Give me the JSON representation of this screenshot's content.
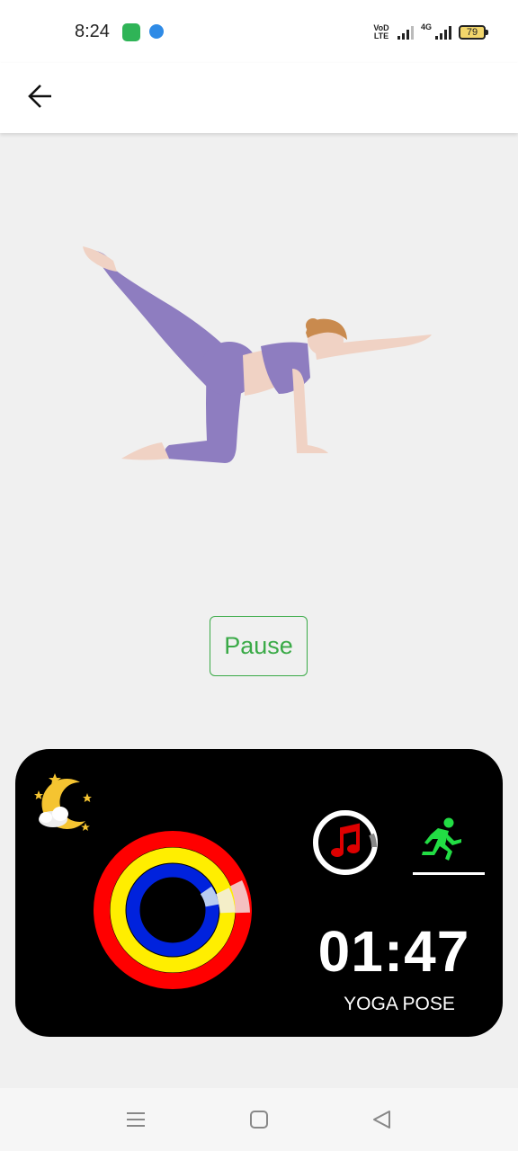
{
  "status_bar": {
    "time": "8:24",
    "volte_line1": "VoD",
    "volte_line2": "LTE",
    "network": "4G",
    "battery": "79",
    "icons": [
      "app-notification-icon",
      "browser-notification-icon",
      "volte-icon",
      "signal-icon",
      "signal-4g-icon",
      "battery-icon"
    ]
  },
  "app_bar": {
    "back_icon": "arrow-left-icon"
  },
  "illustration": {
    "icon": "yoga-pose-illustration"
  },
  "controls": {
    "pause_label": "Pause",
    "accent_color": "#3aaa47"
  },
  "dashboard": {
    "background": "#000000",
    "timer": "01:47",
    "pose_label": "YOGA POSE",
    "icons": [
      "moon-stars-icon",
      "activity-rings",
      "music-note-icon",
      "running-icon"
    ],
    "colors": {
      "outer_ring": "#ff0000",
      "middle_ring": "#ffee00",
      "inner_ring": "#0022dd",
      "run_icon": "#22dd44",
      "music_note": "#dd0000"
    }
  },
  "nav_bar": {
    "icons": [
      "menu-icon",
      "home-icon",
      "back-triangle-icon"
    ]
  }
}
